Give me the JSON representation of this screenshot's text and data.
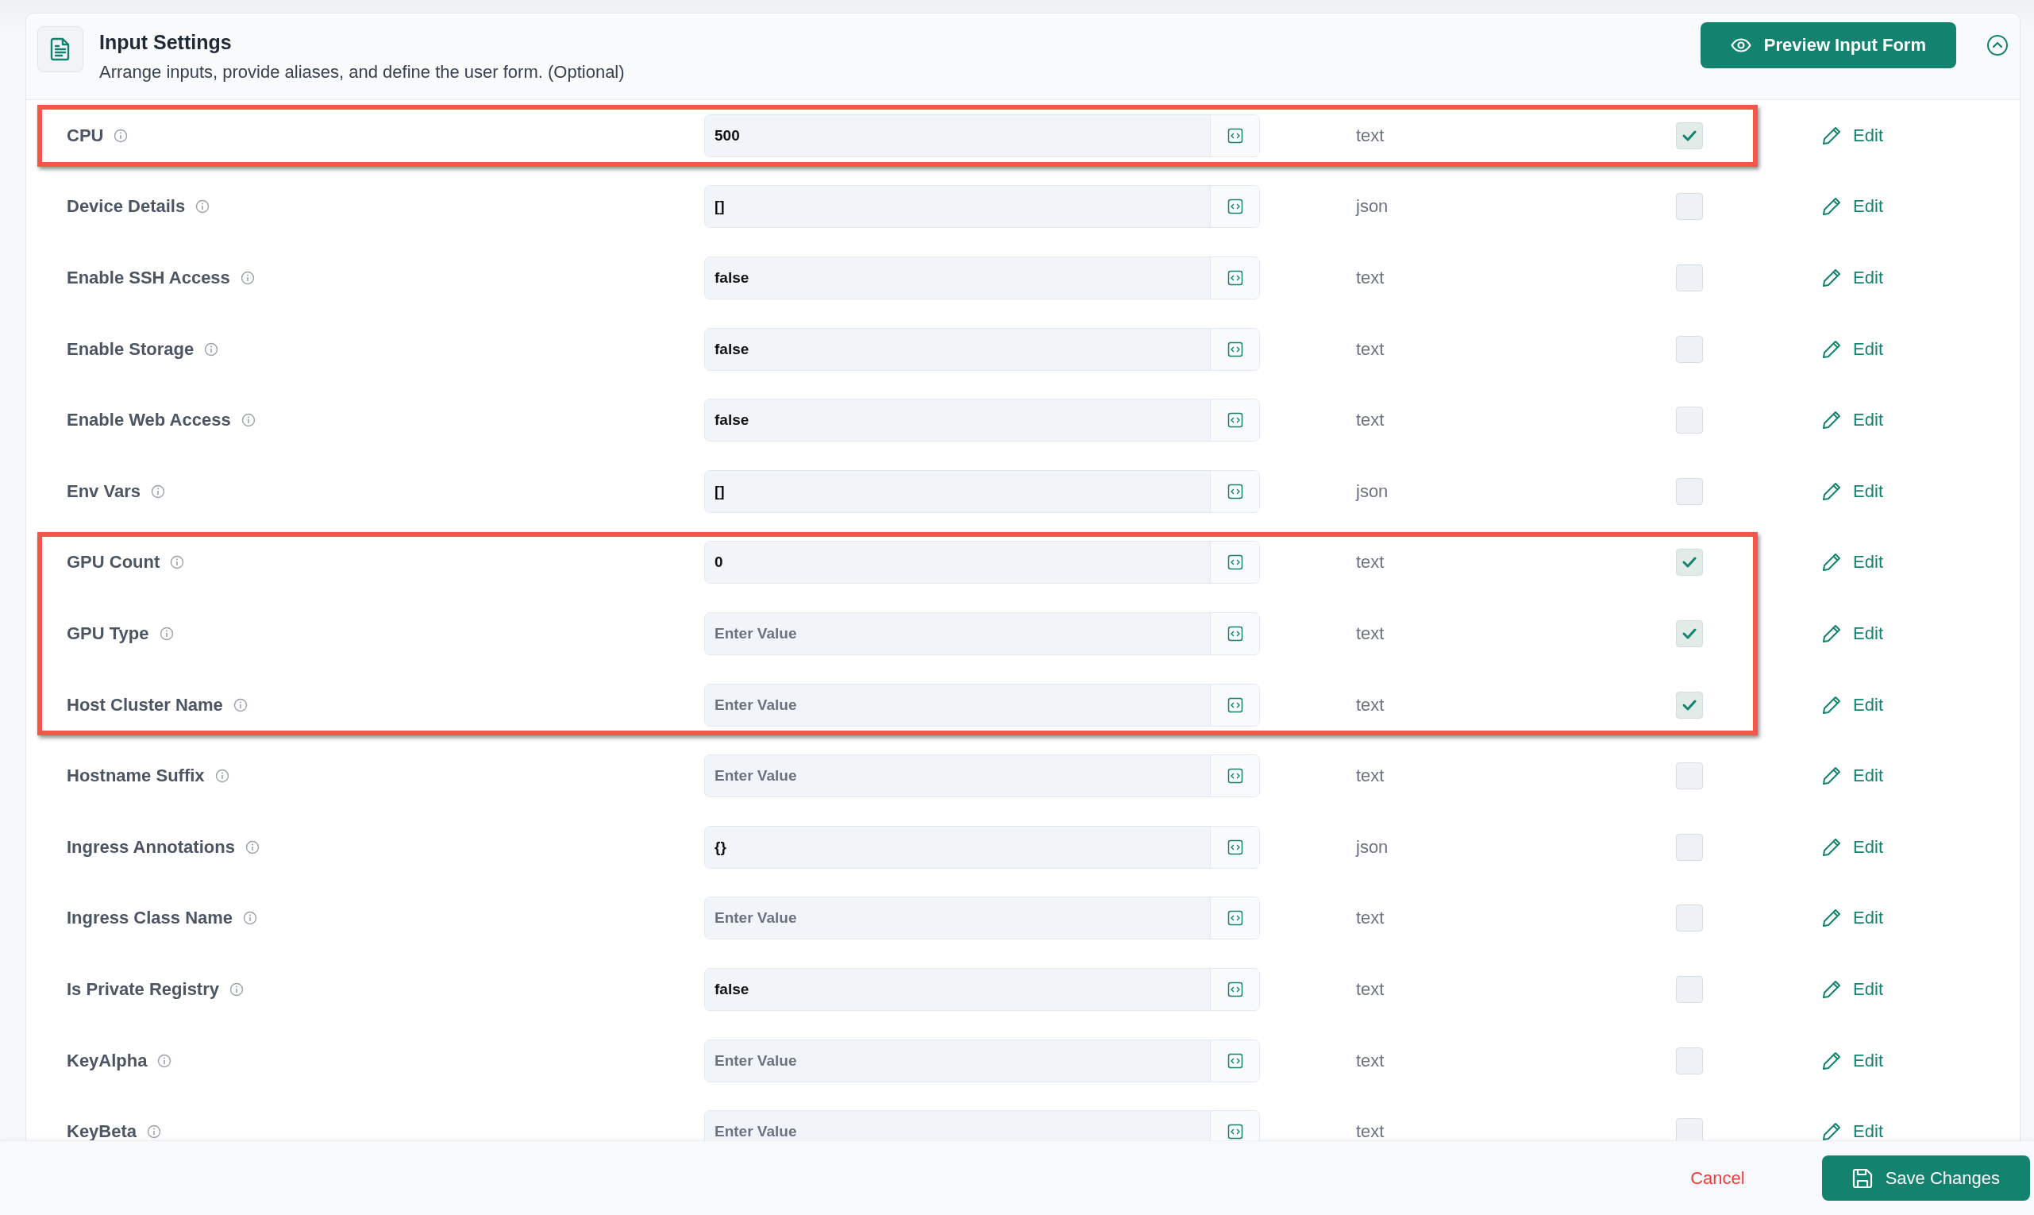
{
  "header": {
    "title": "Input Settings",
    "subtitle": "Arrange inputs, provide aliases, and define the user form. (Optional)",
    "preview_button": "Preview Input Form",
    "expanded": true
  },
  "groups": [
    {
      "highlighted": true,
      "rows": [
        {
          "label": "CPU",
          "value": "500",
          "type": "text",
          "checked": true,
          "action": "Edit"
        }
      ]
    },
    {
      "highlighted": false,
      "rows": [
        {
          "label": "Device Details",
          "value": "[]",
          "type": "json",
          "checked": false,
          "action": "Edit"
        },
        {
          "label": "Enable SSH Access",
          "value": "false",
          "type": "text",
          "checked": false,
          "action": "Edit"
        },
        {
          "label": "Enable Storage",
          "value": "false",
          "type": "text",
          "checked": false,
          "action": "Edit"
        },
        {
          "label": "Enable Web Access",
          "value": "false",
          "type": "text",
          "checked": false,
          "action": "Edit"
        },
        {
          "label": "Env Vars",
          "value": "[]",
          "type": "json",
          "checked": false,
          "action": "Edit"
        }
      ]
    },
    {
      "highlighted": true,
      "rows": [
        {
          "label": "GPU Count",
          "value": "0",
          "type": "text",
          "checked": true,
          "action": "Edit"
        },
        {
          "label": "GPU Type",
          "placeholder": "Enter Value",
          "type": "text",
          "checked": true,
          "action": "Edit"
        },
        {
          "label": "Host Cluster Name",
          "placeholder": "Enter Value",
          "type": "text",
          "checked": true,
          "action": "Edit"
        }
      ]
    },
    {
      "highlighted": false,
      "rows": [
        {
          "label": "Hostname Suffix",
          "placeholder": "Enter Value",
          "type": "text",
          "checked": false,
          "action": "Edit"
        },
        {
          "label": "Ingress Annotations",
          "value": "{}",
          "type": "json",
          "checked": false,
          "action": "Edit"
        },
        {
          "label": "Ingress Class Name",
          "placeholder": "Enter Value",
          "type": "text",
          "checked": false,
          "action": "Edit"
        },
        {
          "label": "Is Private Registry",
          "value": "false",
          "type": "text",
          "checked": false,
          "action": "Edit"
        },
        {
          "label": "KeyAlpha",
          "placeholder": "Enter Value",
          "type": "text",
          "checked": false,
          "action": "Edit"
        },
        {
          "label": "KeyBeta",
          "placeholder": "Enter Value",
          "type": "text",
          "checked": false,
          "action": "Edit"
        }
      ]
    }
  ],
  "footer": {
    "cancel": "Cancel",
    "save": "Save Changes"
  }
}
